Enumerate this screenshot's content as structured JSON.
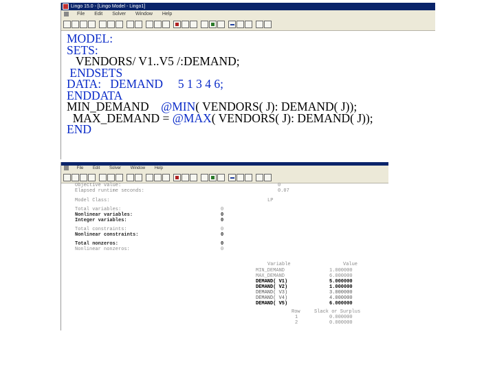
{
  "model_window": {
    "title": "Lingo 15.0 - [Lingo Model - Lingo1]",
    "menu": [
      "File",
      "Edit",
      "Solver",
      "Window",
      "Help"
    ],
    "code": [
      {
        "text": "MODEL:",
        "kind": "kw",
        "indent": ""
      },
      {
        "text": "SETS:",
        "kind": "kw",
        "indent": ""
      },
      {
        "text": "VENDORS/ V1..V5 /:DEMAND;",
        "kind": "plain",
        "indent": "   "
      },
      {
        "text": "ENDSETS",
        "kind": "kw",
        "indent": " "
      },
      {
        "text": "DATA:   DEMAND     5 1 3 4 6;",
        "kind": "mixed",
        "indent": ""
      },
      {
        "text": "ENDDATA",
        "kind": "kw",
        "indent": ""
      },
      {
        "text": "MIN_DEMAND",
        "kind": "minline",
        "indent": ""
      },
      {
        "text": "MAX_DEMAND",
        "kind": "maxline",
        "indent": "  "
      },
      {
        "text": "END",
        "kind": "kw",
        "indent": ""
      }
    ],
    "line_min": {
      "lhs": "MIN_DEMAND",
      "eq": "=",
      "fn": "@MIN",
      "rest": "( VENDORS( J): DEMAND( J));"
    },
    "line_max": {
      "lhs": "MAX_DEMAND =",
      "fn": "@MAX",
      "rest": "( VENDORS( J): DEMAND( J));"
    }
  },
  "report_window": {
    "menu": [
      "File",
      "Edit",
      "Solver",
      "Window",
      "Help"
    ],
    "header_lines": [
      {
        "text": "Objective value:",
        "value": "0"
      },
      {
        "text": "Elapsed runtime seconds:",
        "value": "0.07"
      },
      {
        "text": "Model Class:",
        "value": "LP"
      }
    ],
    "stats": [
      {
        "label": "Total variables:",
        "value": "0",
        "style": "faint"
      },
      {
        "label": "Nonlinear variables:",
        "value": "0",
        "style": "bold"
      },
      {
        "label": "Integer variables:",
        "value": "0",
        "style": "bold"
      },
      {
        "label": "Total constraints:",
        "value": "0",
        "style": "faint"
      },
      {
        "label": "Nonlinear constraints:",
        "value": "0",
        "style": "bold"
      },
      {
        "label": "Total nonzeros:",
        "value": "0",
        "style": "bold"
      },
      {
        "label": "Nonlinear nonzeros:",
        "value": "0",
        "style": "faint"
      }
    ],
    "var_header": {
      "variable": "Variable",
      "value": "Value"
    },
    "variables": [
      {
        "name": "MIN_DEMAND",
        "value": "1.000000"
      },
      {
        "name": "MAX_DEMAND",
        "value": "6.000000"
      },
      {
        "name": "DEMAND( V1)",
        "value": "5.000000"
      },
      {
        "name": "DEMAND( V2)",
        "value": "1.000000"
      },
      {
        "name": "DEMAND( V3)",
        "value": "3.000000"
      },
      {
        "name": "DEMAND( V4)",
        "value": "4.000000"
      },
      {
        "name": "DEMAND( V5)",
        "value": "6.000000"
      }
    ],
    "row_header": {
      "row": "Row",
      "slack": "Slack or Surplus"
    },
    "rows": [
      {
        "row": "1",
        "slack": "0.000000"
      },
      {
        "row": "2",
        "slack": "0.000000"
      }
    ]
  },
  "colors": {
    "keyword": "#0a2bc8",
    "titlebar": "#0a246a",
    "chrome": "#ece9d8"
  }
}
